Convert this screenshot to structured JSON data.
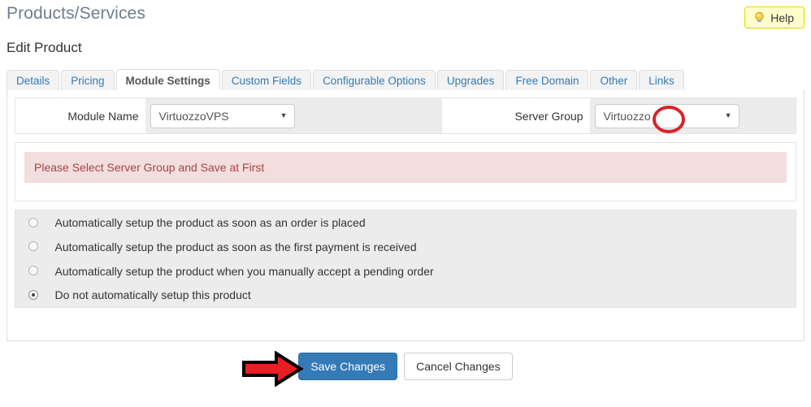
{
  "header": {
    "page_title": "Products/Services",
    "sub_title": "Edit Product",
    "help_label": "Help",
    "help_icon": "lightbulb-icon",
    "help_bg": "#ffffcc",
    "help_border": "#e8d600"
  },
  "tabs": [
    {
      "label": "Details",
      "active": false
    },
    {
      "label": "Pricing",
      "active": false
    },
    {
      "label": "Module Settings",
      "active": true
    },
    {
      "label": "Custom Fields",
      "active": false
    },
    {
      "label": "Configurable Options",
      "active": false
    },
    {
      "label": "Upgrades",
      "active": false
    },
    {
      "label": "Free Domain",
      "active": false
    },
    {
      "label": "Other",
      "active": false
    },
    {
      "label": "Links",
      "active": false
    }
  ],
  "module_row": {
    "module_name_label": "Module Name",
    "module_name_value": "VirtuozzoVPS",
    "server_group_label": "Server Group",
    "server_group_value": "Virtuozzo",
    "caret_glyph": "▼"
  },
  "alert": {
    "message": "Please Select Server Group and Save at First",
    "bg": "#f2dede",
    "text_color": "#a94442"
  },
  "setup_options": [
    {
      "label": "Automatically setup the product as soon as an order is placed",
      "selected": false
    },
    {
      "label": "Automatically setup the product as soon as the first payment is received",
      "selected": false
    },
    {
      "label": "Automatically setup the product when you manually accept a pending order",
      "selected": false
    },
    {
      "label": "Do not automatically setup this product",
      "selected": true
    }
  ],
  "footer": {
    "save_label": "Save Changes",
    "cancel_label": "Cancel Changes",
    "save_bg": "#337ab7"
  },
  "annotations": {
    "arrow_color": "#e81e25",
    "arrow_outline": "#000000",
    "circle_color": "#d8232a"
  }
}
